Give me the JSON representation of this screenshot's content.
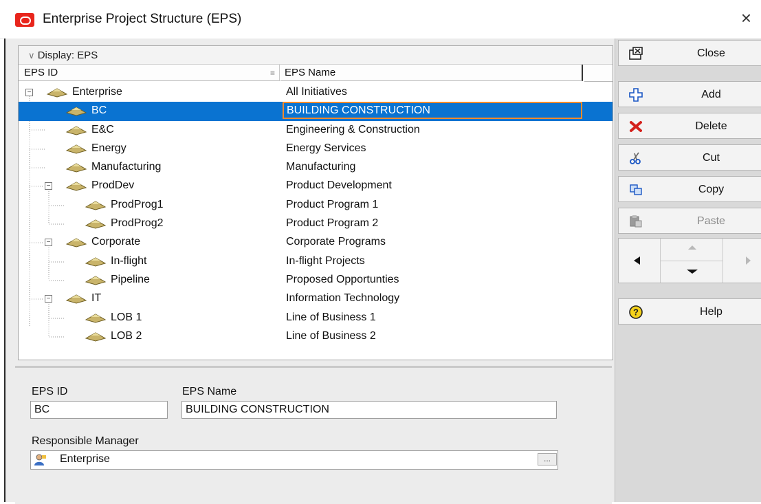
{
  "window": {
    "title": "Enterprise Project Structure (EPS)",
    "close_glyph": "×"
  },
  "tree": {
    "display_label": "Display: EPS",
    "columns": {
      "id": "EPS ID",
      "name": "EPS Name"
    },
    "rows": [
      {
        "id": "Enterprise",
        "name": "All Initiatives",
        "level": 0,
        "expanded": true,
        "selected": false
      },
      {
        "id": "BC",
        "name": "BUILDING CONSTRUCTION",
        "level": 1,
        "expanded": null,
        "selected": true
      },
      {
        "id": "E&C",
        "name": "Engineering & Construction",
        "level": 1,
        "expanded": null,
        "selected": false
      },
      {
        "id": "Energy",
        "name": "Energy Services",
        "level": 1,
        "expanded": null,
        "selected": false
      },
      {
        "id": "Manufacturing",
        "name": "Manufacturing",
        "level": 1,
        "expanded": null,
        "selected": false
      },
      {
        "id": "ProdDev",
        "name": "Product Development",
        "level": 1,
        "expanded": true,
        "selected": false
      },
      {
        "id": "ProdProg1",
        "name": "Product Program 1",
        "level": 2,
        "expanded": null,
        "selected": false
      },
      {
        "id": "ProdProg2",
        "name": "Product Program 2",
        "level": 2,
        "expanded": null,
        "selected": false
      },
      {
        "id": "Corporate",
        "name": "Corporate Programs",
        "level": 1,
        "expanded": true,
        "selected": false
      },
      {
        "id": "In-flight",
        "name": "In-flight Projects",
        "level": 2,
        "expanded": null,
        "selected": false
      },
      {
        "id": "Pipeline",
        "name": "Proposed Opportunties",
        "level": 2,
        "expanded": null,
        "selected": false
      },
      {
        "id": "IT",
        "name": "Information Technology",
        "level": 1,
        "expanded": true,
        "selected": false
      },
      {
        "id": "LOB 1",
        "name": "Line of Business 1",
        "level": 2,
        "expanded": null,
        "selected": false
      },
      {
        "id": "LOB 2",
        "name": "Line of Business 2",
        "level": 2,
        "expanded": null,
        "selected": false
      }
    ]
  },
  "buttons": {
    "close": "Close",
    "add": "Add",
    "delete": "Delete",
    "cut": "Cut",
    "copy": "Copy",
    "paste": "Paste",
    "help": "Help"
  },
  "details": {
    "eps_id_label": "EPS ID",
    "eps_id_value": "BC",
    "eps_name_label": "EPS Name",
    "eps_name_value": "BUILDING CONSTRUCTION",
    "manager_label": "Responsible Manager",
    "manager_value": "Enterprise",
    "browse_label": "..."
  },
  "colors": {
    "selection": "#0a73d1",
    "focus_border": "#f08a2c",
    "oracle_red": "#e8251c",
    "node_icon": "#c9b46a"
  }
}
